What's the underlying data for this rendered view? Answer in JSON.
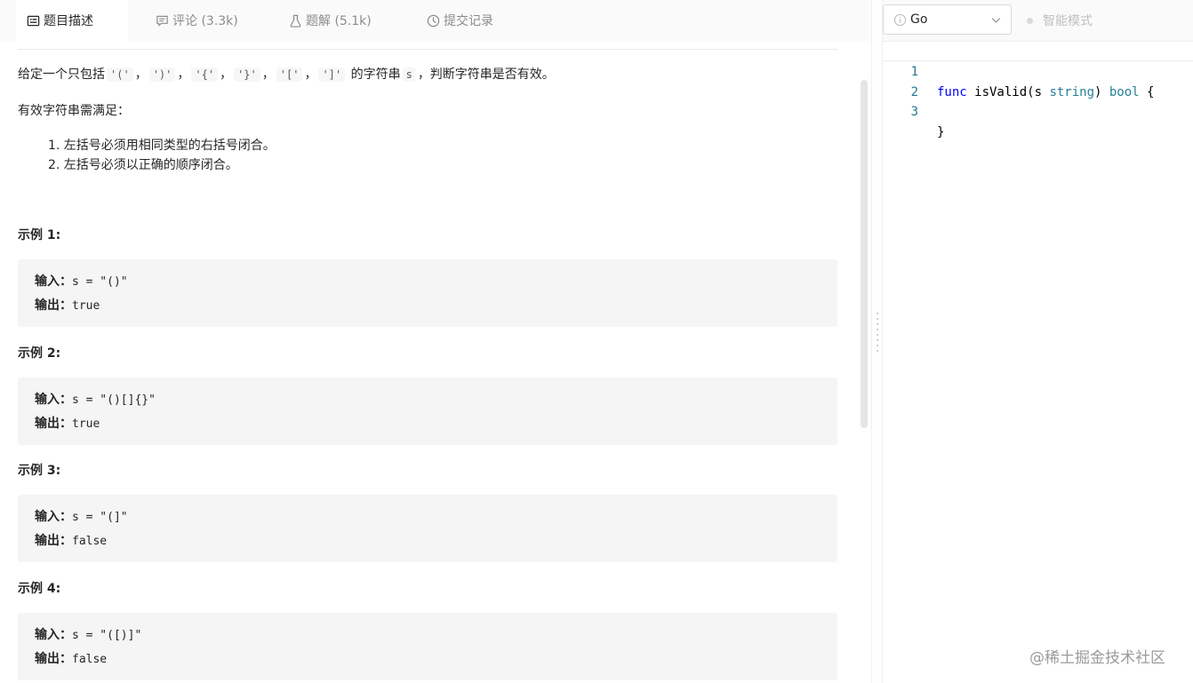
{
  "tabs": [
    {
      "label": "题目描述",
      "icon": "description-icon"
    },
    {
      "label": "评论 (3.3k)",
      "icon": "comment-icon"
    },
    {
      "label": "题解 (5.1k)",
      "icon": "flask-icon"
    },
    {
      "label": "提交记录",
      "icon": "clock-icon"
    }
  ],
  "problem": {
    "intro_before": "给定一个只包括",
    "brackets": [
      "'('",
      "')'",
      "'{'",
      "'}'",
      "'['",
      "']'"
    ],
    "comma": "，",
    "intro_mid": "的字符串",
    "var_s": "s",
    "intro_after": "，判断字符串是否有效。",
    "valid_title": "有效字符串需满足：",
    "rules": [
      "1. 左括号必须用相同类型的右括号闭合。",
      "2. 左括号必须以正确的顺序闭合。"
    ]
  },
  "examples": [
    {
      "title": "示例 1:",
      "input_label": "输入：",
      "input": "s = \"()\"",
      "output_label": "输出：",
      "output": "true"
    },
    {
      "title": "示例 2:",
      "input_label": "输入：",
      "input": "s = \"()[]{}\"",
      "output_label": "输出：",
      "output": "true"
    },
    {
      "title": "示例 3:",
      "input_label": "输入：",
      "input": "s = \"(]\"",
      "output_label": "输出：",
      "output": "false"
    },
    {
      "title": "示例 4:",
      "input_label": "输入：",
      "input": "s = \"([)]\"",
      "output_label": "输出：",
      "output": "false"
    }
  ],
  "editor": {
    "language": "Go",
    "smart_mode_label": "智能模式",
    "code": {
      "line1": {
        "num": "1",
        "kw": "func",
        "name": " isValid(s ",
        "type": "string",
        "close": ") ",
        "ret": "bool",
        "brace": " {"
      },
      "line2": {
        "num": "2"
      },
      "line3": {
        "num": "3",
        "text": "}"
      }
    }
  },
  "watermark": "@稀土掘金技术社区",
  "colors": {
    "keyword": "#0000ff",
    "type": "#267f99",
    "line_number": "#237893"
  }
}
